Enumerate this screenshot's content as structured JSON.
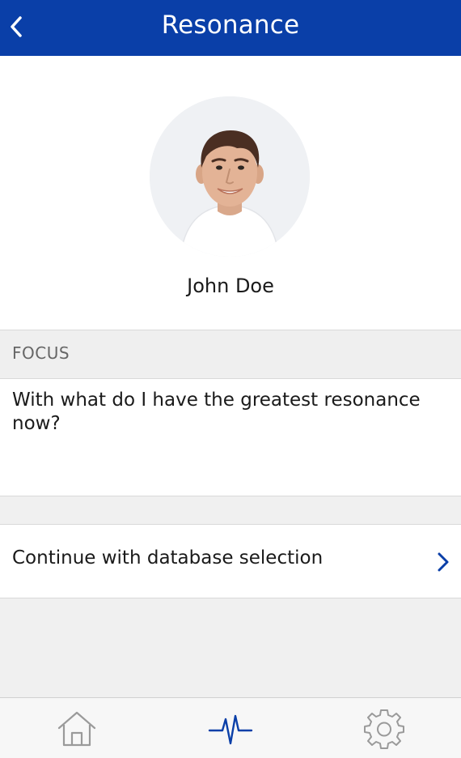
{
  "header": {
    "title": "Resonance",
    "bg_color": "#0a3fa8"
  },
  "profile": {
    "name": "John Doe"
  },
  "focus": {
    "section_label": "FOCUS",
    "question": "With what do I have the greatest resonance now?"
  },
  "actions": {
    "continue_label": "Continue with database selection"
  },
  "tabbar": {
    "tabs": [
      {
        "icon": "home-icon",
        "active": false
      },
      {
        "icon": "pulse-icon",
        "active": true
      },
      {
        "icon": "gear-icon",
        "active": false
      }
    ]
  },
  "colors": {
    "accent": "#0a3fa8",
    "inactive_icon": "#9a9a9a"
  }
}
